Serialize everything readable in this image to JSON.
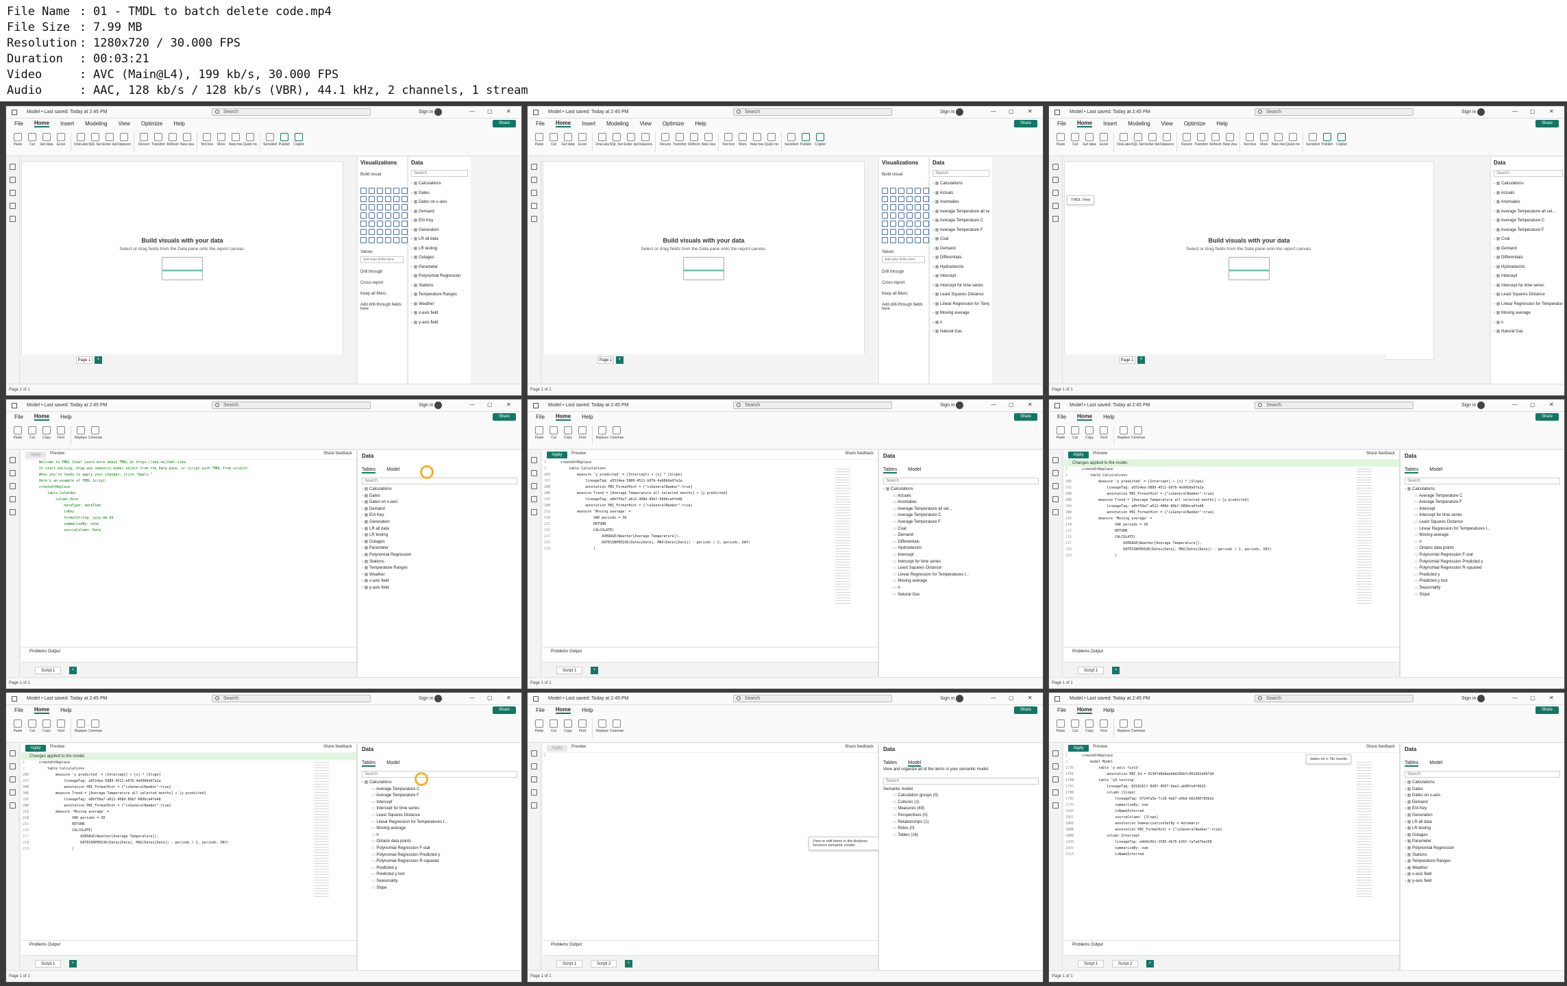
{
  "header": {
    "rows": [
      {
        "key": "File Name",
        "value": "01 - TMDL to batch delete code.mp4"
      },
      {
        "key": "File Size",
        "value": "7.99 MB"
      },
      {
        "key": "Resolution",
        "value": "1280x720 / 30.000 FPS"
      },
      {
        "key": "Duration",
        "value": "00:03:21"
      },
      {
        "key": "Video",
        "value": "AVC (Main@L4), 199 kb/s, 30.000 FPS"
      },
      {
        "key": "Audio",
        "value": "AAC, 128 kb/s / 128 kb/s (VBR), 44.1 kHz, 2 channels, 1 stream"
      }
    ]
  },
  "app": {
    "title": "Model • Last saved: Today at 2:45 PM",
    "search_placeholder": "Search",
    "signin": "Sign in",
    "share": "Share",
    "menus_report": [
      "File",
      "Home",
      "Insert",
      "Modeling",
      "View",
      "Optimize",
      "Help"
    ],
    "menus_tmdl": [
      "File",
      "Home",
      "Help"
    ],
    "ribbon_report": [
      "Paste",
      "Cut",
      "Get data",
      "Excel",
      "OneLake",
      "SQL Server",
      "Enter data",
      "Dataverse",
      "Recent",
      "Transform",
      "Refresh",
      "New visual",
      "Text box",
      "More",
      "New measure",
      "Quick measure",
      "Sensitivity",
      "Publish",
      "Copilot"
    ],
    "ribbon_tmdl": [
      "Paste",
      "Cut",
      "Copy",
      "Find",
      "Replace",
      "Command palette"
    ],
    "empty_title": "Build visuals with your data",
    "empty_sub": "Select or drag fields from the Data pane onto the report canvas.",
    "page_tab": "Page 1",
    "page_status": "Page 1 of 1",
    "visualizations": "Visualizations",
    "build_visual": "Build visual",
    "values_label": "Values",
    "add_fields": "Add data fields here",
    "drill": "Drill through",
    "cross": "Cross-report",
    "keep": "Keep all filters",
    "add_drill": "Add drill-through fields here",
    "data": "Data",
    "tables_tab": "Tables",
    "model_tab": "Model",
    "apply": "Apply",
    "preview": "Preview",
    "share_feedback": "Share feedback",
    "changes_applied": "Changes applied to the model.",
    "problems": "Problems",
    "output": "Output",
    "script1": "Script 1",
    "script2": "Script 2",
    "tmdl_view": "TMDL View",
    "semantic_tip": "View or edit items in the Analysis Services semantic model.",
    "no_results": "No results",
    "find_text": "dates on x-"
  },
  "tables": [
    "Calculations",
    "Dates",
    "Dates on x-axis",
    "Demand",
    "EIA Key",
    "Generation",
    "LR all data",
    "LR testing",
    "Outages",
    "Parameter",
    "Polynomial Regression",
    "Stations",
    "Temperature Ranges",
    "Weather",
    "x-axis field",
    "y-axis field"
  ],
  "calc_measures": [
    "Actuals",
    "Anomalies",
    "Average Temperature all sel...",
    "Average Temperature C",
    "Average Temperature F",
    "Coal",
    "Demand",
    "Differentials",
    "Hydroelectric",
    "Intercept",
    "Intercept for time series",
    "Least Squares Distance",
    "Linear Regression for Temperatures I...",
    "Moving average",
    "n",
    "Natural Gas"
  ],
  "calc_measures2": [
    "Average Temperature C",
    "Average Temperature F",
    "Intercept",
    "Intercept for time series",
    "Least Squares Distance",
    "Linear Regression for Temperatures I...",
    "Moving average",
    "n",
    "Ontario data points",
    "Polynomial Regression F-stat",
    "Polynomial Regression Predicted y",
    "Polynomial Regression R-squared",
    "Predicted y",
    "Predicted y test",
    "Seasonality",
    "Slope"
  ],
  "model_items": [
    "Semantic model",
    "Calculation groups (0)",
    "Cultures (1)",
    "Measures (49)",
    "Perspectives (0)",
    "Relationships (1)",
    "Roles (0)",
    "Tables (16)"
  ],
  "model_tip": "View and organize all of the items in your semantic model.",
  "code_welcome": [
    "Welcome to TMDL View! Learn more about TMDL at https://aka.ms/tmdl-view",
    "",
    "To start editing, drag any semantic model object from the Data pane, or script with TMDL from scratch.",
    "When you're ready to apply your changes, click \"Apply.\"",
    "",
    "Here's an example of TMDL Script:",
    "",
    "createOrReplace",
    "",
    "    table Calendar",
    "",
    "        column Date",
    "            dataType: dateTime",
    "            isKey",
    "            formatString: yyyy-mm-dd",
    "            summarizeBy: none",
    "            sourceColumn: Date"
  ],
  "code_calc": [
    [
      "1",
      "createOrReplace"
    ],
    [
      "2",
      "    table Calculations"
    ],
    [
      "201",
      ""
    ],
    [
      "202",
      "        measure 'y predicted' = [Intercept] + [x] * [Slope]"
    ],
    [
      "203",
      "            lineageTag: a5514ea-5889-4511-b07b-4a90b0a97a1a"
    ],
    [
      "204",
      ""
    ],
    [
      "205",
      "            annotation PBI_FormatHint = {\"isGeneralNumber\":true}"
    ],
    [
      "206",
      ""
    ],
    [
      "207",
      "        measure Trend = [Average Temperature all selected months] + [y predicted]"
    ],
    [
      "208",
      "            lineageTag: a0bf59a7-a612-408d-89bf-689bca4fe48"
    ],
    [
      "209",
      ""
    ],
    [
      "210",
      "            annotation PBI_FormatHint = {\"isGeneralNumber\":true}"
    ],
    [
      "211",
      ""
    ],
    [
      "212",
      "        measure 'Moving average' ="
    ],
    [
      "213",
      ""
    ],
    [
      "214",
      "                VAR periods = 30"
    ],
    [
      "215",
      "                RETURN"
    ],
    [
      "216",
      "                CALCULATE("
    ],
    [
      "217",
      "                    AVERAGE(Weather[Average Temperature]),"
    ],
    [
      "218",
      "                    DATESINPERIOD(Dates[Date], MAX(Dates[Date]) - periods / 2, periods, DAY)"
    ],
    [
      "219",
      "                )"
    ]
  ],
  "code_model": [
    [
      "1",
      "createOrReplace"
    ],
    [
      "2",
      "    model Model"
    ],
    [
      "1790",
      "        table 'y-axis field'"
    ],
    [
      "1791",
      ""
    ],
    [
      "1792",
      "            annotation PBI_Id = 0130fd8b8add4d289b7c961b62d497d0"
    ],
    [
      "1793",
      ""
    ],
    [
      "1794",
      "        table 'LR testing'"
    ],
    [
      "1795",
      "            lineageTag: 8318261f-9d0f-4567-9aa1-ab09fe4f9625"
    ],
    [
      "1796",
      ""
    ],
    [
      "1797",
      "            column [Slope]"
    ],
    [
      "1798",
      "                lineageTag: 0724fa5e-7c18-4ab7-a9bd-b62485f83b2e"
    ],
    [
      "1799",
      "                summarizeBy: sum"
    ],
    [
      "1800",
      "                isNameInferred"
    ],
    [
      "1801",
      "                sourceColumn: [Slope]"
    ],
    [
      "1802",
      ""
    ],
    [
      "1803",
      "                annotation SummarizationSetBy = Automatic"
    ],
    [
      "1804",
      ""
    ],
    [
      "1805",
      "                annotation PBI_FormatHint = {\"isGeneralNumber\":true}"
    ],
    [
      "1806",
      ""
    ],
    [
      "1807",
      "            column Intercept"
    ],
    [
      "1808",
      "                lineageTag: e4d4c0b1-1585-4b76-b26f-fa7ab7da158"
    ],
    [
      "1809",
      "                summarizeBy: sum"
    ],
    [
      "1810",
      "                isNameInferred"
    ]
  ]
}
